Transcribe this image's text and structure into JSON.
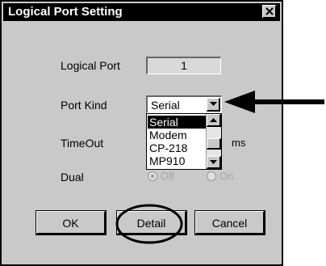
{
  "dialog": {
    "title": "Logical Port Setting",
    "close_symbol": "×"
  },
  "form": {
    "logical_port_label": "Logical Port",
    "logical_port_value": "1",
    "port_kind_label": "Port Kind",
    "port_kind_selected": "Serial",
    "port_kind_options": [
      "Serial",
      "Modem",
      "CP-218",
      "MP910"
    ],
    "timeout_label": "TimeOut",
    "timeout_unit": "ms",
    "dual_label": "Dual",
    "dual_off": "Off",
    "dual_on": "On"
  },
  "buttons": {
    "ok": "OK",
    "detail": "Detail",
    "cancel": "Cancel"
  },
  "annotation_colors": {
    "arrow": "#000000",
    "circle": "#000000"
  }
}
